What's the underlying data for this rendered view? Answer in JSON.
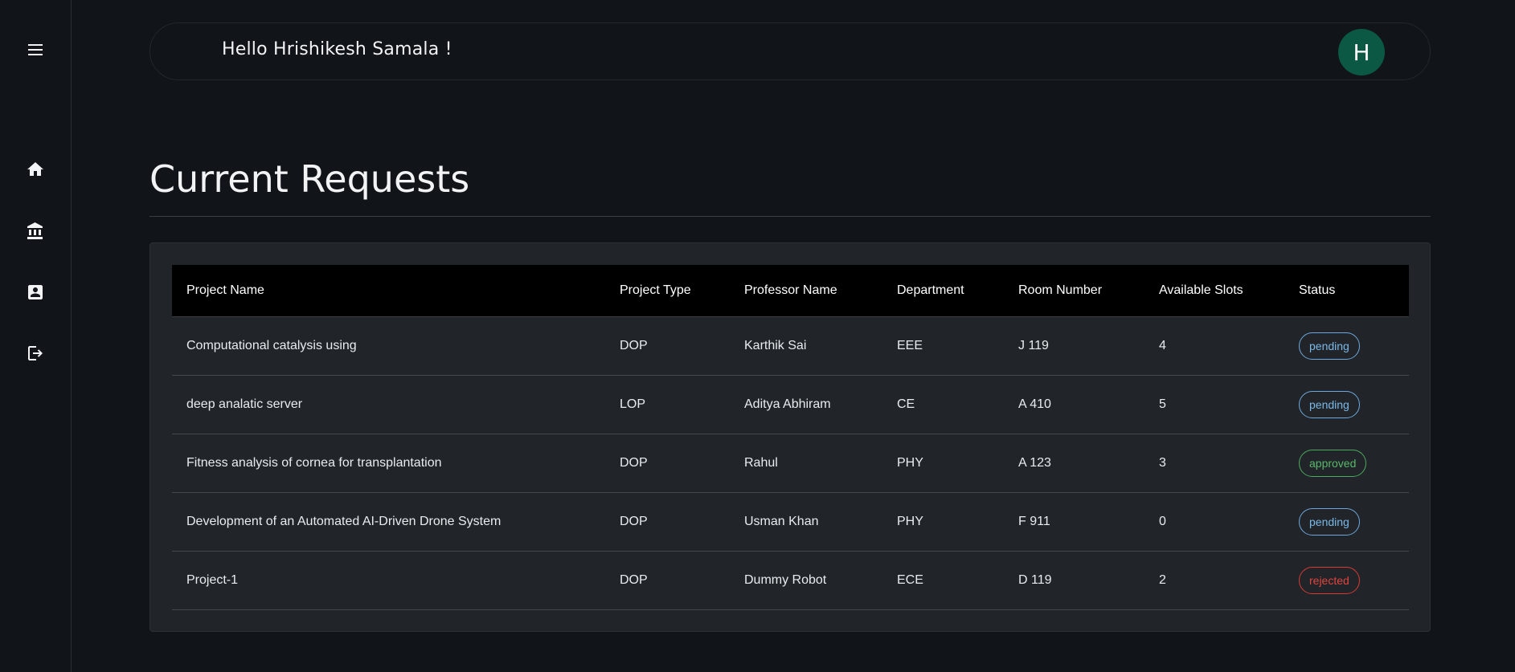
{
  "sidebar": {
    "items": [
      {
        "icon": "menu-icon",
        "label": ""
      },
      {
        "icon": "home-icon",
        "label": ""
      },
      {
        "icon": "institution-icon",
        "label": ""
      },
      {
        "icon": "contact-card-icon",
        "label": ""
      },
      {
        "icon": "logout-icon",
        "label": ""
      }
    ]
  },
  "header": {
    "greeting": "Hello Hrishikesh Samala !",
    "avatar_letter": "H",
    "avatar_color": "#0b5944"
  },
  "main": {
    "title": "Current Requests",
    "table": {
      "columns": [
        "Project Name",
        "Project Type",
        "Professor Name",
        "Department",
        "Room Number",
        "Available Slots",
        "Status"
      ],
      "rows": [
        {
          "project_name": "Computational catalysis using",
          "project_type": "DOP",
          "professor": "Karthik Sai",
          "department": "EEE",
          "room": "J 119",
          "slots": "4",
          "status": "pending"
        },
        {
          "project_name": "deep analatic server",
          "project_type": "LOP",
          "professor": "Aditya Abhiram",
          "department": "CE",
          "room": "A 410",
          "slots": "5",
          "status": "pending"
        },
        {
          "project_name": "Fitness analysis of cornea for transplantation",
          "project_type": "DOP",
          "professor": "Rahul",
          "department": "PHY",
          "room": "A 123",
          "slots": "3",
          "status": "approved"
        },
        {
          "project_name": "Development of an Automated AI-Driven Drone System",
          "project_type": "DOP",
          "professor": "Usman Khan",
          "department": "PHY",
          "room": "F 911",
          "slots": "0",
          "status": "pending"
        },
        {
          "project_name": "Project-1",
          "project_type": "DOP",
          "professor": "Dummy Robot",
          "department": "ECE",
          "room": "D 119",
          "slots": "2",
          "status": "rejected"
        }
      ]
    }
  },
  "colors": {
    "background": "#111418",
    "card": "#212529",
    "pending": "#6ea8dc",
    "approved": "#4caa5d",
    "rejected": "#d83a34"
  }
}
